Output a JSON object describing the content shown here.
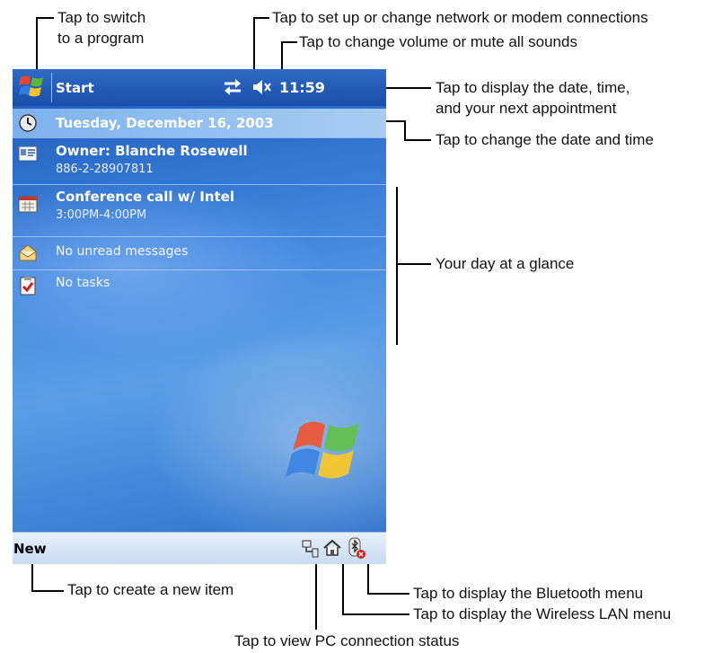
{
  "screen": {
    "nav": {
      "start_label": "Start",
      "clock": "11:59"
    },
    "today": {
      "date": "Tuesday, December 16, 2003",
      "owner_name": "Owner: Blanche Rosewell",
      "owner_phone": "886-2-28907811",
      "appointment_title": "Conference call w/ Intel",
      "appointment_time": "3:00PM-4:00PM",
      "messages": "No unread messages",
      "tasks": "No tasks"
    },
    "command_bar": {
      "new_label": "New"
    }
  },
  "annotations": {
    "switch_program_line1": "Tap to switch",
    "switch_program_line2": "to a program",
    "network": "Tap to set up or change network or modem connections",
    "volume": "Tap to change volume or mute all sounds",
    "date_time_line1": "Tap to display the date, time,",
    "date_time_line2": "and your next appointment",
    "change_date": "Tap to change the date and time",
    "glance": "Your day at a glance",
    "new_item": "Tap to create a new item",
    "bluetooth": "Tap to display the Bluetooth menu",
    "wlan": "Tap to display the Wireless LAN menu",
    "pc_connection": "Tap to view PC connection status"
  },
  "icons": [
    "windows-start-icon",
    "connection-icon",
    "volume-icon",
    "clock-icon",
    "owner-card-icon",
    "calendar-icon",
    "inbox-icon",
    "tasks-icon",
    "pc-connection-icon",
    "wireless-lan-home-icon",
    "bluetooth-icon",
    "windows-logo"
  ]
}
